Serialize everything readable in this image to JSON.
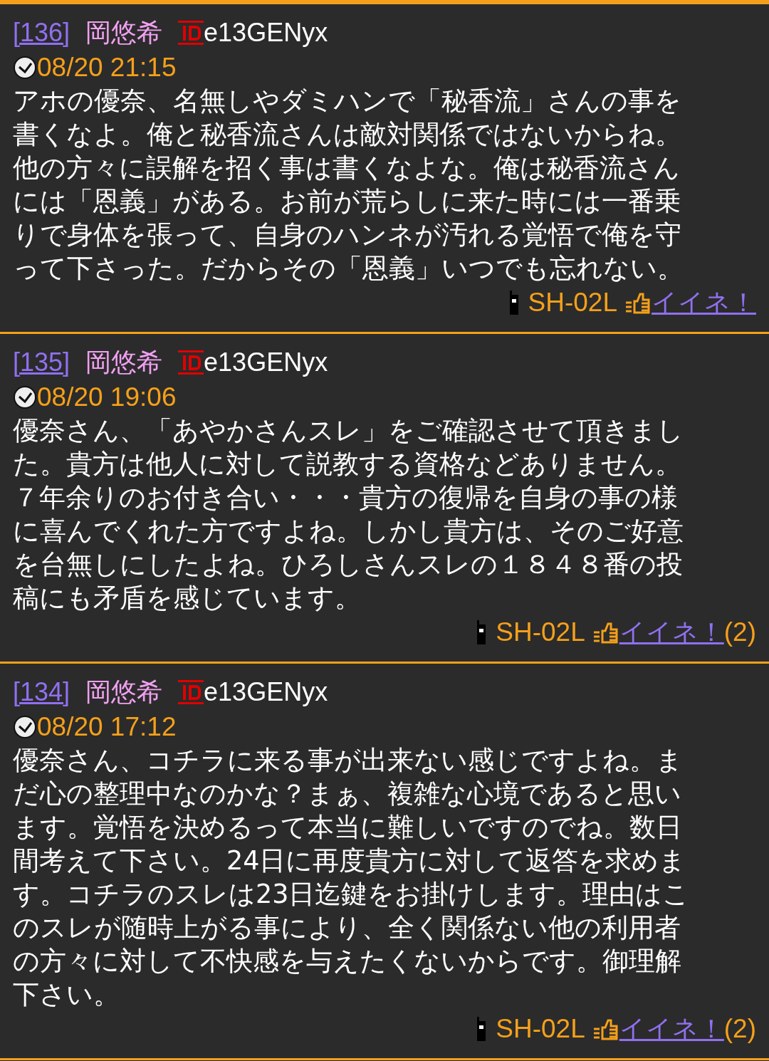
{
  "posts": [
    {
      "number": "[136]",
      "name": "岡悠希",
      "id": "e13GENyx",
      "time": "08/20 21:15",
      "lines": [
        "アホの優奈、名無しやダミハンで「秘香流」さんの事を",
        "書くなよ。俺と秘香流さんは敵対関係ではないからね。",
        "他の方々に誤解を招く事は書くなよな。俺は秘香流さん",
        "には「恩義」がある。お前が荒らしに来た時には一番乗",
        "りで身体を張って、自身のハンネが汚れる覚悟で俺を守",
        "って下さった。だからその「恩義」いつでも忘れない。"
      ],
      "device": "SH-02L",
      "like": "イイネ！"
    },
    {
      "number": "[135]",
      "name": "岡悠希",
      "id": "e13GENyx",
      "time": "08/20 19:06",
      "lines": [
        "優奈さん、「あやかさんスレ」をご確認させて頂きまし",
        "た。貴方は他人に対して説教する資格などありません。",
        "７年余りのお付き合い・・・貴方の復帰を自身の事の様",
        "に喜んでくれた方ですよね。しかし貴方は、そのご好意",
        "を台無しにしたよね。ひろしさんスレの１８４８番の投",
        "稿にも矛盾を感じています。"
      ],
      "device": "SH-02L",
      "like": "イイネ！",
      "like_count": "(2)"
    },
    {
      "number": "[134]",
      "name": "岡悠希",
      "id": "e13GENyx",
      "time": "08/20 17:12",
      "lines": [
        "優奈さん、コチラに来る事が出来ない感じですよね。ま",
        "だ心の整理中なのかな？まぁ、複雑な心境であると思い",
        "ます。覚悟を決めるって本当に難しいですのでね。数日",
        "間考えて下さい。24日に再度貴方に対して返答を求めま",
        "す。コチラのスレは23日迄鍵をお掛けします。理由はこ",
        "のスレが随時上がる事により、全く関係ない他の利用者",
        "の方々に対して不快感を与えたくないからです。御理解",
        "下さい。"
      ],
      "device": "SH-02L",
      "like": "イイネ！",
      "like_count": "(2)"
    }
  ]
}
